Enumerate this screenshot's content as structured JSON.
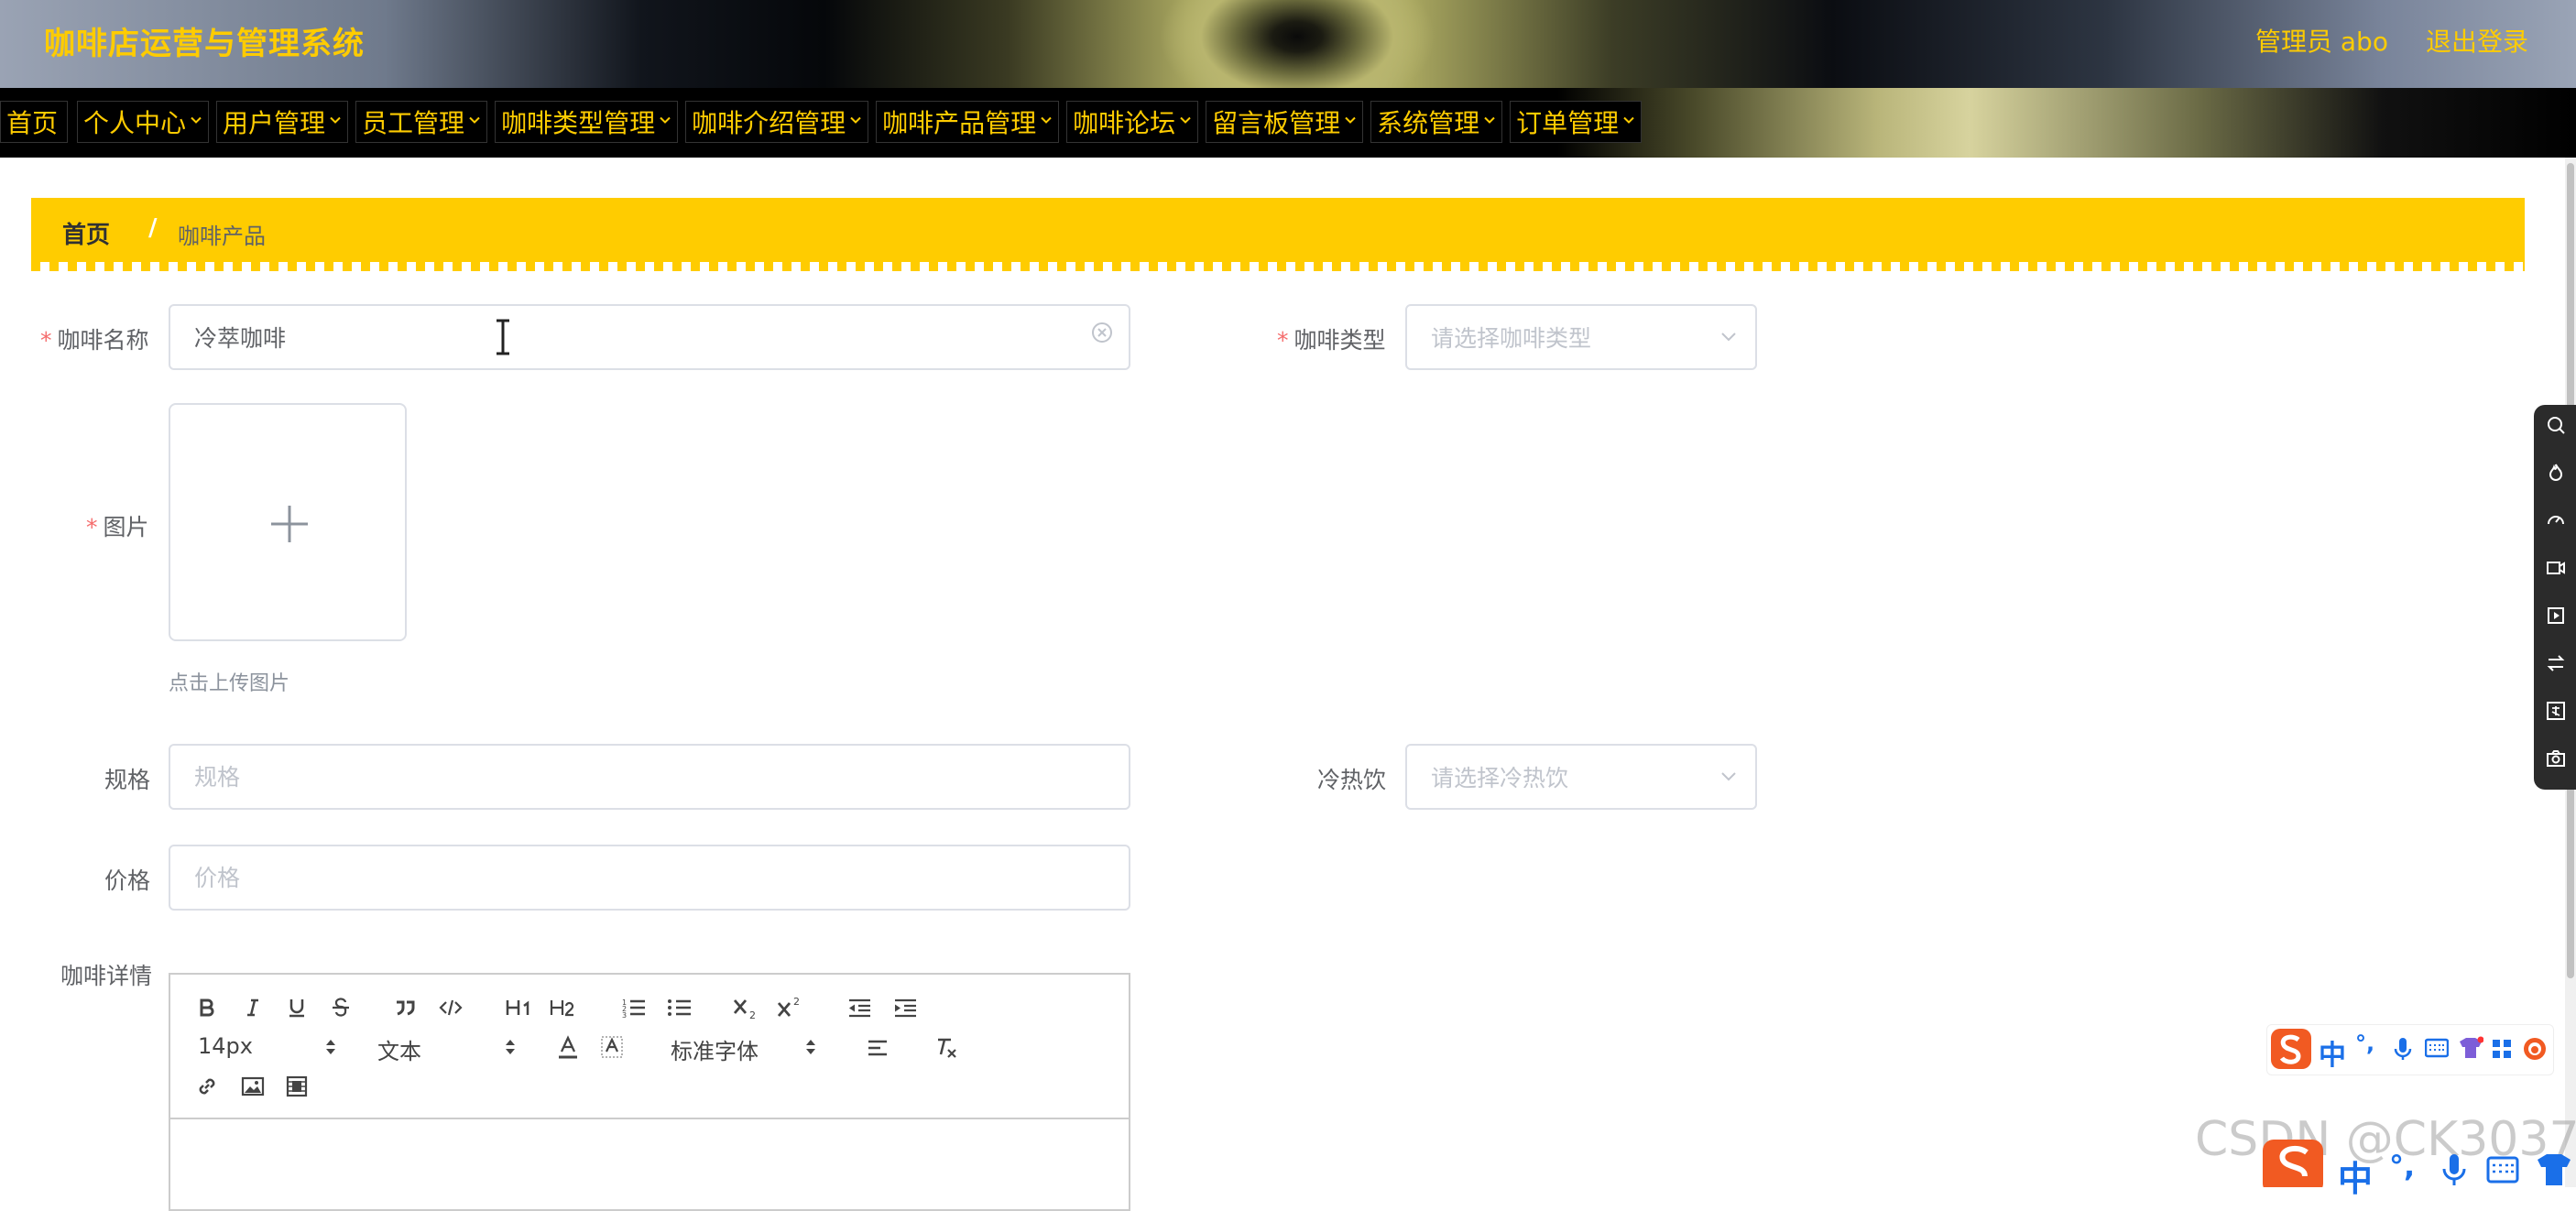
{
  "header": {
    "app_title": "咖啡店运营与管理系统",
    "user_label": "管理员 abo",
    "logout_label": "退出登录"
  },
  "nav": {
    "items": [
      {
        "label": "首页",
        "has_dropdown": false
      },
      {
        "label": "个人中心",
        "has_dropdown": true
      },
      {
        "label": "用户管理",
        "has_dropdown": true
      },
      {
        "label": "员工管理",
        "has_dropdown": true
      },
      {
        "label": "咖啡类型管理",
        "has_dropdown": true
      },
      {
        "label": "咖啡介绍管理",
        "has_dropdown": true
      },
      {
        "label": "咖啡产品管理",
        "has_dropdown": true
      },
      {
        "label": "咖啡论坛",
        "has_dropdown": true
      },
      {
        "label": "留言板管理",
        "has_dropdown": true
      },
      {
        "label": "系统管理",
        "has_dropdown": true
      },
      {
        "label": "订单管理",
        "has_dropdown": true
      }
    ]
  },
  "breadcrumb": {
    "home": "首页",
    "separator": "/",
    "current": "咖啡产品"
  },
  "form": {
    "name": {
      "label": "咖啡名称",
      "required": true,
      "value": "冷萃咖啡"
    },
    "type": {
      "label": "咖啡类型",
      "required": true,
      "placeholder": "请选择咖啡类型"
    },
    "image": {
      "label": "图片",
      "required": true,
      "hint": "点击上传图片"
    },
    "spec": {
      "label": "规格",
      "placeholder": "规格"
    },
    "temperature": {
      "label": "冷热饮",
      "placeholder": "请选择冷热饮"
    },
    "price": {
      "label": "价格",
      "placeholder": "价格"
    },
    "detail": {
      "label": "咖啡详情"
    }
  },
  "editor": {
    "font_size": "14px",
    "header_select": "文本",
    "font_family": "标准字体"
  },
  "ime": {
    "zh_label": "中",
    "punct_label": "°,"
  },
  "watermark": "CSDN @CK3037",
  "colors": {
    "accent": "#ffcc00",
    "nav_bg": "#000000",
    "required": "#f56c6c",
    "border": "#dcdfe6",
    "placeholder": "#c0c4cc"
  }
}
